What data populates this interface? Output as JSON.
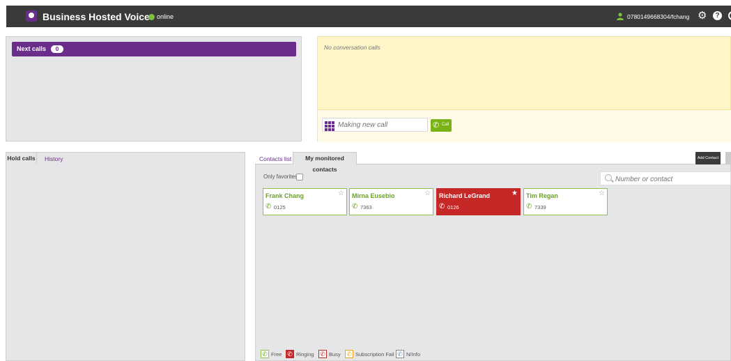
{
  "header": {
    "app_title": "Business Hosted Voice",
    "status": "online",
    "user": "0780149668304/fchang",
    "colors": {
      "bar": "#3a3a3a",
      "brand": "#6b2d8c",
      "online": "#7ac142"
    }
  },
  "next_calls": {
    "label": "Next calls",
    "count": "0"
  },
  "conversation": {
    "empty_text": "No conversation calls",
    "new_call_placeholder": "Making new call",
    "call_button": "Call"
  },
  "left_tabs": {
    "hold_calls": "Hold calls",
    "history": "History"
  },
  "right_tabs": {
    "contacts_list": "Contacts list",
    "monitored": "My monitored contacts",
    "add_contact": "Add Contact"
  },
  "filters": {
    "only_favorites": "Only favorites",
    "search_placeholder": "Number or contact"
  },
  "contacts": [
    {
      "name": "Frank Chang",
      "number": "0125",
      "status": "free"
    },
    {
      "name": "Mirna Eusebio",
      "number": "7363",
      "status": "free"
    },
    {
      "name": "Richard LeGrand",
      "number": "0126",
      "status": "ringing"
    },
    {
      "name": "Tim Regan",
      "number": "7339",
      "status": "free"
    }
  ],
  "legend": {
    "free": "Free",
    "ringing": "Ringing",
    "busy": "Busy",
    "subscription_fail": "Subscription Fail",
    "ninfo": "N/Info"
  }
}
